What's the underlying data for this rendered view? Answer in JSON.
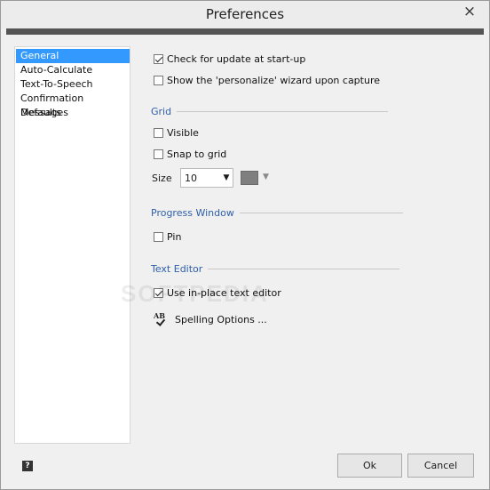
{
  "window": {
    "title": "Preferences",
    "close_glyph": "×",
    "watermark": "SOFTPEDIA"
  },
  "sidebar": {
    "items": [
      {
        "label": "General",
        "selected": true
      },
      {
        "label": "Auto-Calculate",
        "selected": false
      },
      {
        "label": "Text-To-Speech",
        "selected": false
      },
      {
        "label": "Confirmation Messages",
        "selected": false
      },
      {
        "label": "Defaults",
        "selected": false
      }
    ]
  },
  "general": {
    "check_update": {
      "label": "Check for update at start-up",
      "checked": true
    },
    "personalize_wizard": {
      "label": "Show the 'personalize' wizard upon capture",
      "checked": false
    }
  },
  "grid": {
    "title": "Grid",
    "visible": {
      "label": "Visible",
      "checked": false
    },
    "snap": {
      "label": "Snap to grid",
      "checked": false
    },
    "size_label": "Size",
    "size_value": "10",
    "color": "#7f7f7f"
  },
  "progress_window": {
    "title": "Progress Window",
    "pin": {
      "label": "Pin",
      "checked": false
    }
  },
  "text_editor": {
    "title": "Text Editor",
    "in_place": {
      "label": "Use in-place text editor",
      "checked": true
    },
    "spelling_label": "Spelling Options ...",
    "spelling_icon_text": "AB"
  },
  "footer": {
    "help_label": "?",
    "ok_label": "Ok",
    "cancel_label": "Cancel"
  },
  "colors": {
    "accent_bar": "#555555",
    "selection": "#3399ff",
    "group_title": "#2f5faa"
  }
}
